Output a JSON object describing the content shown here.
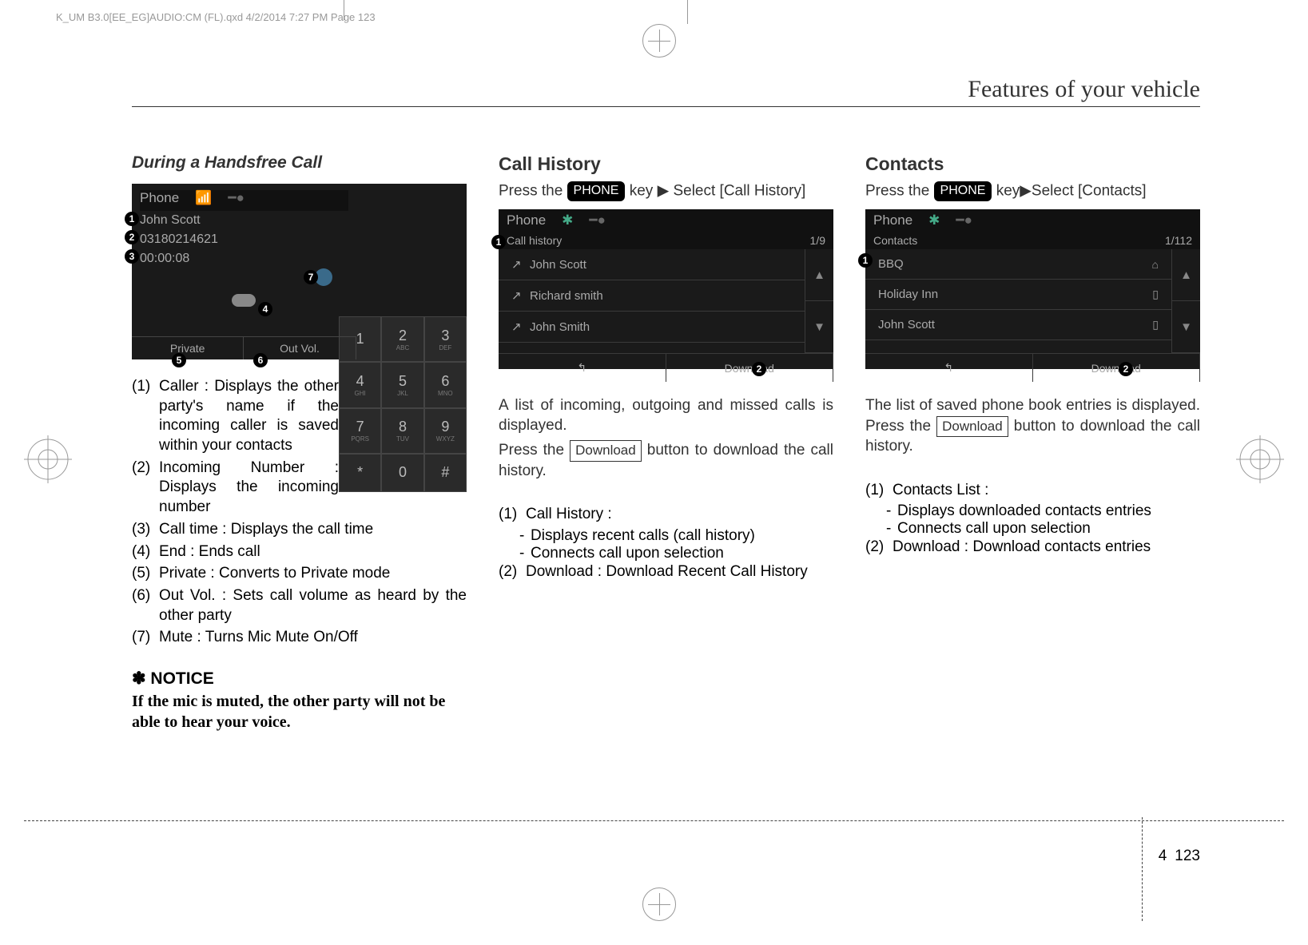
{
  "fileMetadata": "K_UM B3.0[EE_EG]AUDIO:CM (FL).qxd    4/2/2014    7:27 PM    Page 123",
  "runningHead": "Features of your vehicle",
  "col1": {
    "title": "During a Handsfree Call",
    "screen": {
      "header": "Phone",
      "caller": "John Scott",
      "number": "03180214621",
      "time": "00:00:08",
      "bottomLeft": "Private",
      "bottomRight": "Out Vol."
    },
    "keypad": [
      "1",
      "2",
      "3",
      "4",
      "5",
      "6",
      "7",
      "8",
      "9",
      "*",
      "0",
      "#"
    ],
    "keypadSub": [
      "",
      "ABC",
      "DEF",
      "GHI",
      "JKL",
      "MNO",
      "PQRS",
      "TUV",
      "WXYZ",
      "",
      "",
      ""
    ],
    "items": [
      "Caller : Displays the other party's name if the incoming caller is saved within your contacts",
      "Incoming Number : Displays the incoming number",
      "Call time : Displays the call time",
      "End : Ends call",
      "Private : Converts to Private mode",
      "Out Vol. : Sets call volume as heard by the other party",
      "Mute : Turns Mic Mute On/Off"
    ],
    "noticeLabel": "✽ NOTICE",
    "noticeText": "If the mic is muted, the other party will not be able to hear your voice."
  },
  "col2": {
    "title": "Call History",
    "intro1": "Press the ",
    "btnPhone": "PHONE",
    "intro2": " key ▶ Select [Call History]",
    "screen": {
      "header": "Phone",
      "subheader": "Call history",
      "count": "1/9",
      "items": [
        "John Scott",
        "Richard smith",
        "John Smith"
      ],
      "footerRight": "Download"
    },
    "desc1": "A list of incoming, outgoing and missed calls is displayed.",
    "desc2a": "Press the ",
    "btnDownload": "Download",
    "desc2b": " button to download the call history.",
    "numbered": [
      {
        "title": "Call History :",
        "subs": [
          "Displays recent calls (call history)",
          "Connects call upon selection"
        ]
      },
      {
        "title": "Download : Download Recent Call History",
        "subs": []
      }
    ]
  },
  "col3": {
    "title": "Contacts",
    "intro1": "Press the ",
    "btnPhone": "PHONE",
    "intro2": " key▶Select [Contacts]",
    "screen": {
      "header": "Phone",
      "subheader": "Contacts",
      "count": "1/112",
      "items": [
        {
          "name": "BBQ",
          "icon": "home"
        },
        {
          "name": "Holiday Inn",
          "icon": "mobile"
        },
        {
          "name": "John Scott",
          "icon": "mobile"
        }
      ],
      "footerRight": "Download"
    },
    "desc1a": "The list of saved phone book entries is displayed. Press the ",
    "btnDownload": "Download",
    "desc1b": " button to download the call history.",
    "numbered": [
      {
        "title": "Contacts List :",
        "subs": [
          "Displays downloaded contacts entries",
          "Connects call upon selection"
        ]
      },
      {
        "title": "Download : Download contacts entries",
        "subs": []
      }
    ]
  },
  "pageFooter": {
    "left": "4",
    "right": "123"
  }
}
